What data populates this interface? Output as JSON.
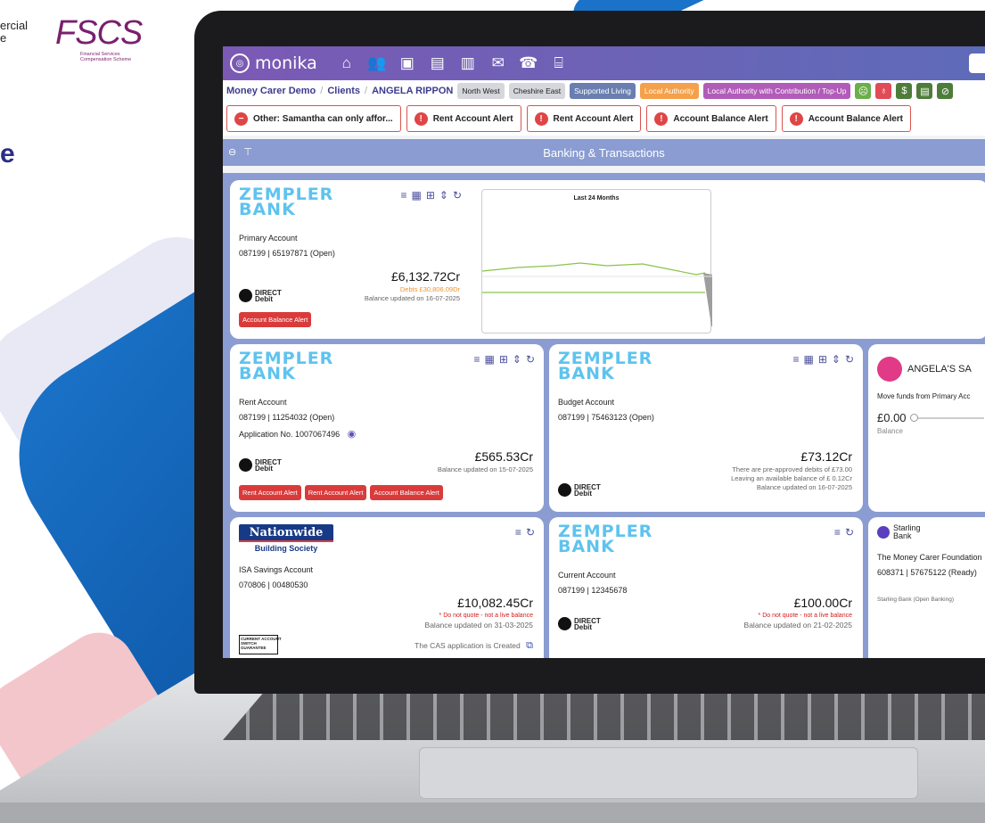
{
  "branding": {
    "left_text": "ercial\ne",
    "big_letter": "e",
    "fscs_logo": "FSCS",
    "fscs_sub": "Financial Services\nCompensation Scheme"
  },
  "app": {
    "name": "monika",
    "nav_icons": [
      "home-icon",
      "users-icon",
      "id-card-icon",
      "document-icon",
      "clipboard-icon",
      "mail-icon",
      "phone-lock-icon",
      "gift-icon"
    ]
  },
  "breadcrumb": {
    "items": [
      "Money Carer Demo",
      "Clients",
      "ANGELA RIPPON"
    ],
    "tags": [
      "North West",
      "Cheshire East",
      "Supported Living",
      "Local Authority",
      "Local Authority with Contribution / Top-Up"
    ]
  },
  "alerts": [
    {
      "label": "Other: Samantha can only affor...",
      "icon": "minus"
    },
    {
      "label": "Rent Account Alert",
      "icon": "!"
    },
    {
      "label": "Rent Account Alert",
      "icon": "!"
    },
    {
      "label": "Account Balance Alert",
      "icon": "!"
    },
    {
      "label": "Account Balance Alert",
      "icon": "!"
    }
  ],
  "section": {
    "title": "Banking & Transactions"
  },
  "bank_logo_text": "ZEMPLER\nBANK",
  "cards": {
    "primary": {
      "name": "Primary Account",
      "sort_acct": "087199 | 65197871 (Open)",
      "balance": "£6,132.72Cr",
      "debts": "Debts £30,806.09Dr",
      "updated": "Balance updated on 16-07-2025",
      "alert_btn": "Account Balance Alert",
      "chart_title": "Last 24 Months"
    },
    "rent": {
      "name": "Rent Account",
      "sort_acct": "087199 | 11254032 (Open)",
      "application": "Application No. 1007067496",
      "balance": "£565.53Cr",
      "updated": "Balance updated on 15-07-2025",
      "alert_btns": [
        "Rent Account Alert",
        "Rent Account Alert",
        "Account Balance Alert"
      ]
    },
    "budget": {
      "name": "Budget Account",
      "sort_acct": "087199 | 75463123 (Open)",
      "balance": "£73.12Cr",
      "note1": "There are pre-approved debits of £73.00",
      "note2": "Leaving an available balance of £ 0.12Cr",
      "updated": "Balance updated on 16-07-2025"
    },
    "savings": {
      "title": "ANGELA'S SA",
      "move": "Move funds from Primary Acc",
      "amount": "£0.00",
      "label": "Balance"
    },
    "nationwide": {
      "logo": "Nationwide",
      "sub": "Building Society",
      "name": "ISA Savings Account",
      "sort_acct": "070806 | 00480530",
      "balance": "£10,082.45Cr",
      "note": "* Do not quote - not a live balance",
      "updated": "Balance updated on 31-03-2025",
      "cas": "The CAS application is Created",
      "switch_label": "CURRENT ACCOUNT\nSWITCH\nGUARANTEE"
    },
    "current": {
      "name": "Current Account",
      "sort_acct": "087199 | 12345678",
      "balance": "£100.00Cr",
      "note": "* Do not quote - not a live balance",
      "updated": "Balance updated on 21-02-2025"
    },
    "starling": {
      "logo": "Starling\nBank",
      "name": "The Money Carer Foundation",
      "sort_acct": "608371 | 57675122 (Ready)",
      "note": "Starling Bank (Open Banking)"
    }
  },
  "direct_debit": "DIRECT\nDebit",
  "colors": {
    "topbar": "#7b59b4",
    "section": "#8a9cd1",
    "zempler": "#5ec3ef",
    "alert_red": "#d93b3b"
  }
}
